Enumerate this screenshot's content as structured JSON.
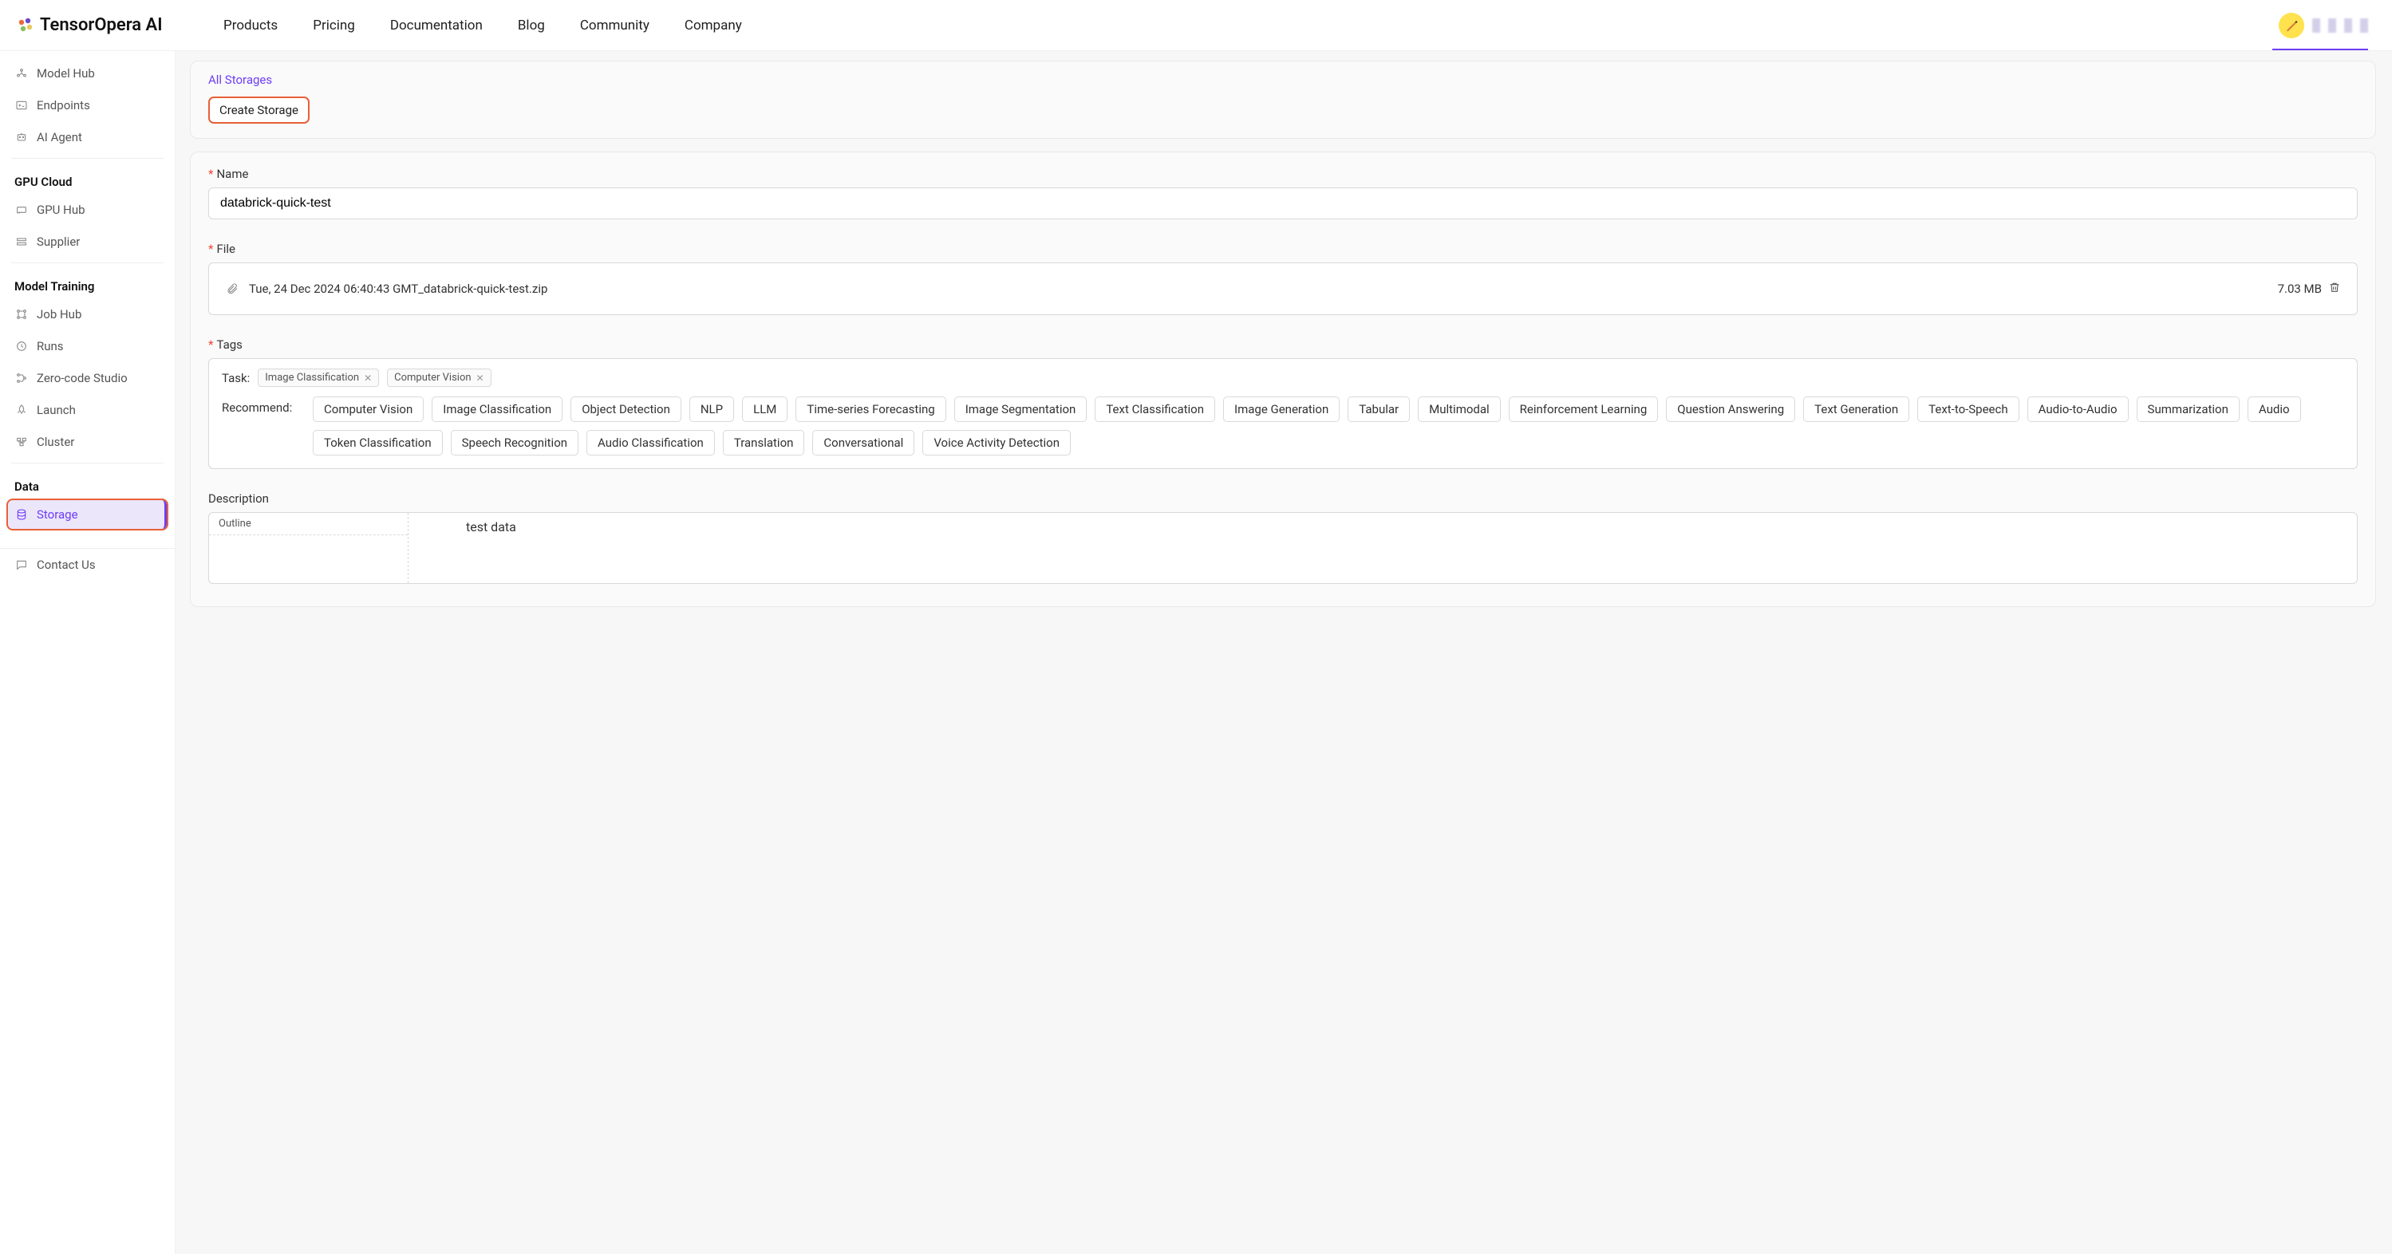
{
  "brand": "TensorOpera AI",
  "nav": [
    "Products",
    "Pricing",
    "Documentation",
    "Blog",
    "Community",
    "Company"
  ],
  "sidebar": {
    "top": [
      {
        "icon": "hub",
        "label": "Model Hub"
      },
      {
        "icon": "terminal",
        "label": "Endpoints"
      },
      {
        "icon": "agent",
        "label": "AI Agent"
      }
    ],
    "gpu_header": "GPU Cloud",
    "gpu": [
      {
        "icon": "gpu",
        "label": "GPU Hub"
      },
      {
        "icon": "supplier",
        "label": "Supplier"
      }
    ],
    "train_header": "Model Training",
    "train": [
      {
        "icon": "job",
        "label": "Job Hub"
      },
      {
        "icon": "runs",
        "label": "Runs"
      },
      {
        "icon": "studio",
        "label": "Zero-code Studio"
      },
      {
        "icon": "launch",
        "label": "Launch"
      },
      {
        "icon": "cluster",
        "label": "Cluster"
      }
    ],
    "data_header": "Data",
    "data": [
      {
        "icon": "storage",
        "label": "Storage",
        "active": true
      }
    ],
    "contact": {
      "icon": "chat",
      "label": "Contact Us"
    }
  },
  "breadcrumb": "All Storages",
  "create_btn": "Create Storage",
  "form": {
    "name_label": "Name",
    "name_value": "databrick-quick-test",
    "file_label": "File",
    "file_name": "Tue, 24 Dec 2024 06:40:43 GMT_databrick-quick-test.zip",
    "file_size": "7.03 MB",
    "tags_label": "Tags",
    "task_label": "Task:",
    "selected_tags": [
      "Image Classification",
      "Computer Vision"
    ],
    "recommend_label": "Recommend:",
    "recommend_tags": [
      "Computer Vision",
      "Image Classification",
      "Object Detection",
      "NLP",
      "LLM",
      "Time-series Forecasting",
      "Image Segmentation",
      "Text Classification",
      "Image Generation",
      "Tabular",
      "Multimodal",
      "Reinforcement Learning",
      "Question Answering",
      "Text Generation",
      "Text-to-Speech",
      "Audio-to-Audio",
      "Summarization",
      "Audio",
      "Token Classification",
      "Speech Recognition",
      "Audio Classification",
      "Translation",
      "Conversational",
      "Voice Activity Detection"
    ],
    "desc_label": "Description",
    "outline_header": "Outline",
    "desc_value": "test data"
  }
}
